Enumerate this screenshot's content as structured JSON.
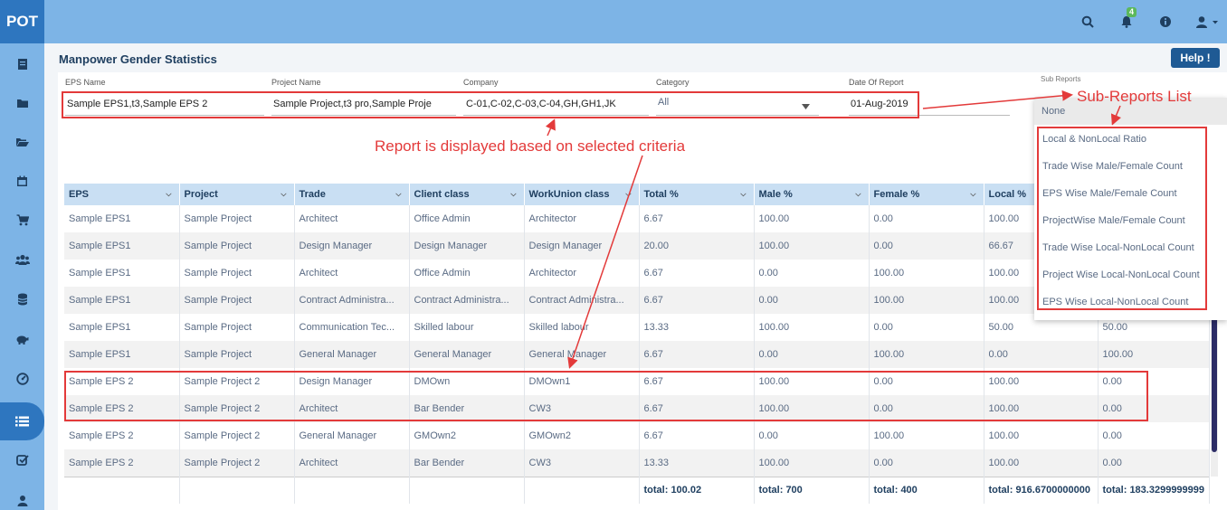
{
  "app": {
    "brand": "POT"
  },
  "topbar": {
    "notification_count": "4"
  },
  "page": {
    "title": "Manpower Gender Statistics",
    "help_label": "Help !"
  },
  "filters": {
    "eps_label": "EPS Name",
    "eps_value": "Sample EPS1,t3,Sample EPS 2",
    "project_label": "Project Name",
    "project_value": "Sample Project,t3 pro,Sample Proje",
    "company_label": "Company",
    "company_value": "C-01,C-02,C-03,C-04,GH,GH1,JK",
    "category_label": "Category",
    "category_value": "All",
    "date_label": "Date Of Report",
    "date_value": "01-Aug-2019",
    "subreports_label": "Sub Reports"
  },
  "subreports": {
    "selected": "None",
    "items": [
      "Local & NonLocal Ratio",
      "Trade Wise Male/Female Count",
      "EPS Wise Male/Female Count",
      "ProjectWise Male/Female Count",
      "Trade Wise Local-NonLocal Count",
      "Project Wise Local-NonLocal Count",
      "EPS Wise Local-NonLocal Count"
    ]
  },
  "table": {
    "columns": [
      "EPS",
      "Project",
      "Trade",
      "Client class",
      "WorkUnion class",
      "Total %",
      "Male %",
      "Female %",
      "Local %",
      ""
    ],
    "rows": [
      [
        "Sample EPS1",
        "Sample Project",
        "Architect",
        "Office Admin",
        "Architector",
        "6.67",
        "100.00",
        "0.00",
        "100.00",
        ""
      ],
      [
        "Sample EPS1",
        "Sample Project",
        "Design Manager",
        "Design Manager",
        "Design Manager",
        "20.00",
        "100.00",
        "0.00",
        "66.67",
        ""
      ],
      [
        "Sample EPS1",
        "Sample Project",
        "Architect",
        "Office Admin",
        "Architector",
        "6.67",
        "0.00",
        "100.00",
        "100.00",
        ""
      ],
      [
        "Sample EPS1",
        "Sample Project",
        "Contract Administra...",
        "Contract Administra...",
        "Contract Administra...",
        "6.67",
        "0.00",
        "100.00",
        "100.00",
        ""
      ],
      [
        "Sample EPS1",
        "Sample Project",
        "Communication Tec...",
        "Skilled labour",
        "Skilled labour",
        "13.33",
        "100.00",
        "0.00",
        "50.00",
        "50.00"
      ],
      [
        "Sample EPS1",
        "Sample Project",
        "General Manager",
        "General Manager",
        "General Manager",
        "6.67",
        "0.00",
        "100.00",
        "0.00",
        "100.00"
      ],
      [
        "Sample EPS 2",
        "Sample Project 2",
        "Design Manager",
        "DMOwn",
        "DMOwn1",
        "6.67",
        "100.00",
        "0.00",
        "100.00",
        "0.00"
      ],
      [
        "Sample EPS 2",
        "Sample Project 2",
        "Architect",
        "Bar Bender",
        "CW3",
        "6.67",
        "100.00",
        "0.00",
        "100.00",
        "0.00"
      ],
      [
        "Sample EPS 2",
        "Sample Project 2",
        "General Manager",
        "GMOwn2",
        "GMOwn2",
        "6.67",
        "0.00",
        "100.00",
        "100.00",
        "0.00"
      ],
      [
        "Sample EPS 2",
        "Sample Project 2",
        "Architect",
        "Bar Bender",
        "CW3",
        "13.33",
        "100.00",
        "0.00",
        "100.00",
        "0.00"
      ]
    ],
    "totals": [
      "",
      "",
      "",
      "",
      "",
      "total: 100.02",
      "total: 700",
      "total: 400",
      "total: 916.6700000000",
      "total: 183.3299999999"
    ]
  },
  "annotations": {
    "subreports_list": "Sub-Reports List",
    "criteria_note": "Report is displayed based on selected criteria"
  },
  "colors": {
    "topbar": "#7db4e6",
    "sidebar_active": "#2e76bf",
    "header_row": "#c9dff3",
    "annotation": "#e33a3a",
    "help_button": "#1f5a94"
  }
}
